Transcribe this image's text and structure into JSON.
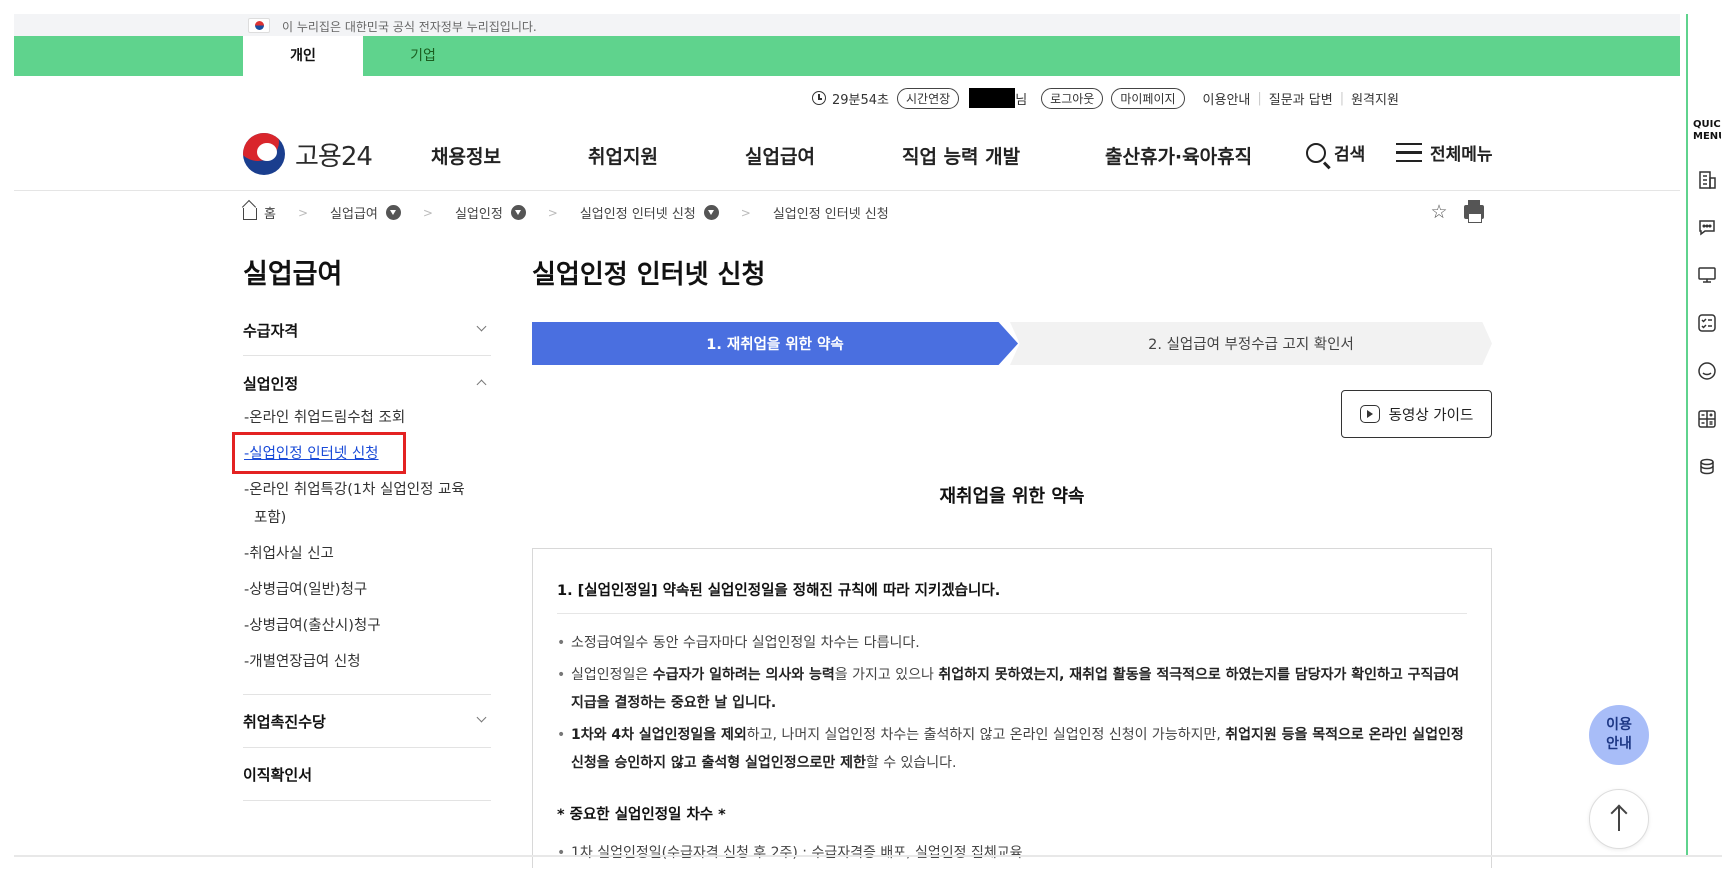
{
  "gov_bar": {
    "text": "이 누리집은 대한민국 공식 전자정부 누리집입니다."
  },
  "top_tabs": [
    {
      "label": "개인",
      "active": true
    },
    {
      "label": "기업",
      "active": false
    }
  ],
  "util": {
    "timer": "29분54초",
    "extend_label": "시간연장",
    "user_suffix": "님",
    "logout_label": "로그아웃",
    "mypage_label": "마이페이지",
    "links": [
      "이용안내",
      "질문과 답변",
      "원격지원"
    ]
  },
  "header": {
    "logo_text": "고용24",
    "gnb": [
      "채용정보",
      "취업지원",
      "실업급여",
      "직업 능력 개발",
      "출산휴가·육아휴직"
    ],
    "search_label": "검색",
    "menu_label": "전체메뉴"
  },
  "breadcrumb": [
    "홈",
    "실업급여",
    "실업인정",
    "실업인정 인터넷 신청",
    "실업인정 인터넷 신청"
  ],
  "sidebar": {
    "title": "실업급여",
    "sections": [
      {
        "label": "수급자격"
      },
      {
        "label": "실업인정"
      },
      {
        "label": "취업촉진수당"
      },
      {
        "label": "이직확인서"
      }
    ],
    "sub_items": [
      "-온라인 취업드림수첩 조회",
      "-실업인정 인터넷 신청",
      "-온라인 취업특강(1차 실업인정 교육",
      "포함)",
      "-취업사실 신고",
      "-상병급여(일반)청구",
      "-상병급여(출산시)청구",
      "-개별연장급여 신청"
    ]
  },
  "main": {
    "title": "실업인정 인터넷 신청",
    "steps": [
      "1. 재취업을 위한 약속",
      "2. 실업급여 부정수급 고지 확인서"
    ],
    "video_label": "동영상 가이드",
    "section_heading": "재취업을 위한 약속",
    "content_title": "1. [실업인정일] 약속된 실업인정일을 정해진 규칙에 따라 지키겠습니다.",
    "bullet1": "소정급여일수 동안 수급자마다 실업인정일 차수는 다릅니다.",
    "bullet2": {
      "p1": "실업인정일은 ",
      "b1": "수급자가 일하려는 의사와 능력",
      "p2": "을 가지고 있으나 ",
      "b2": "취업하지 못하였는지, 재취업 활동을 적극적으로 하였는지를 담당자가 확인하고 구직급여 지급을 결정하는 중요한 날 입니다."
    },
    "bullet3": {
      "b1": "1차와 4차 실업인정일을 제외",
      "p1": "하고, 나머지 실업인정 차수는 출석하지 않고 온라인 실업인정 신청이 가능하지만, ",
      "b2": "취업지원 등을 목적으로 온라인 실업인정 신청을 승인하지 않고 출석형 실업인정으로만 제한",
      "p2": "할 수 있습니다."
    },
    "sub_heading": "* 중요한 실업인정일 차수 *",
    "bullet4": "1차 실업인정일(수급자격 신청 후 2주) : 수급자격증 배포, 실업인정 집체교육"
  },
  "quick": {
    "label": "QUICK MENU",
    "icons": [
      "building-icon",
      "chat-icon",
      "monitor-icon",
      "checklist-icon",
      "smile-icon",
      "calculator-icon",
      "coins-icon"
    ]
  },
  "float": {
    "guide_line1": "이용",
    "guide_line2": "안내"
  },
  "colors": {
    "green": "#5fd38d",
    "step_active": "#4a6fe0",
    "link_blue": "#1a4bd8",
    "highlight_red": "#e32222"
  }
}
